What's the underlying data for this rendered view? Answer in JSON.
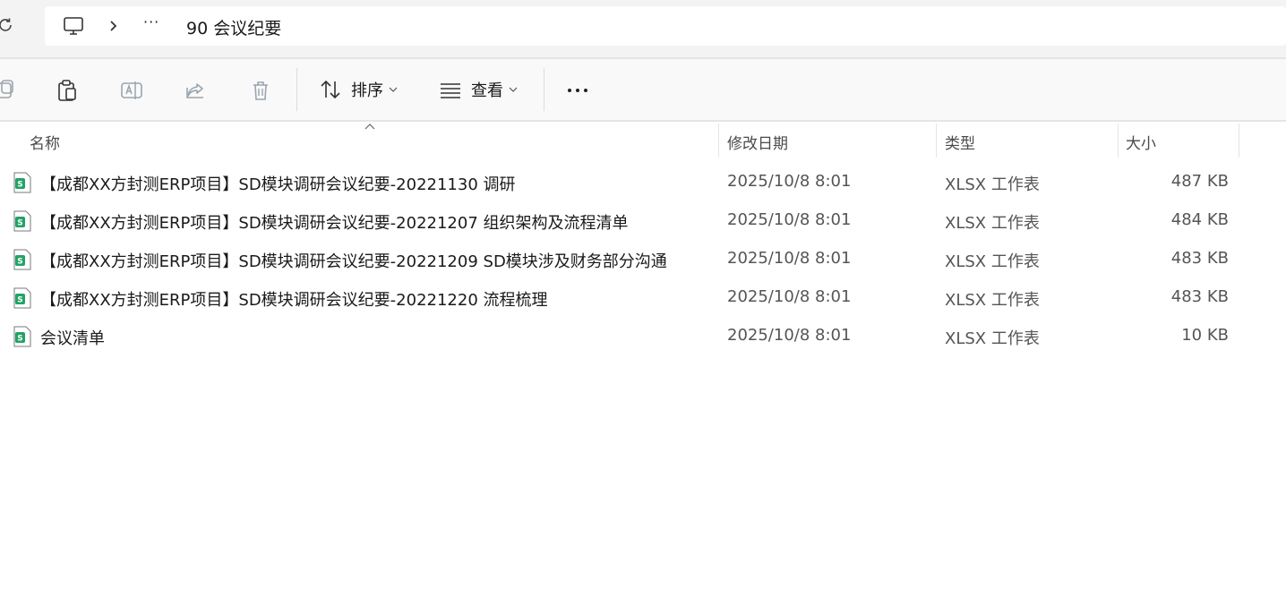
{
  "address": {
    "current_folder": "90 会议纪要",
    "overflow": "···"
  },
  "toolbar": {
    "sort_label": "排序",
    "view_label": "查看",
    "more": "···"
  },
  "columns": {
    "name": "名称",
    "date": "修改日期",
    "type": "类型",
    "size": "大小"
  },
  "files": [
    {
      "name": "【成都XX方封测ERP项目】SD模块调研会议纪要-20221130 调研",
      "date": "2025/10/8 8:01",
      "type": "XLSX 工作表",
      "size": "487 KB"
    },
    {
      "name": "【成都XX方封测ERP项目】SD模块调研会议纪要-20221207 组织架构及流程清单",
      "date": "2025/10/8 8:01",
      "type": "XLSX 工作表",
      "size": "484 KB"
    },
    {
      "name": "【成都XX方封测ERP项目】SD模块调研会议纪要-20221209  SD模块涉及财务部分沟通",
      "date": "2025/10/8 8:01",
      "type": "XLSX 工作表",
      "size": "483 KB"
    },
    {
      "name": "【成都XX方封测ERP项目】SD模块调研会议纪要-20221220 流程梳理",
      "date": "2025/10/8 8:01",
      "type": "XLSX 工作表",
      "size": "483 KB"
    },
    {
      "name": "会议清单",
      "date": "2025/10/8 8:01",
      "type": "XLSX 工作表",
      "size": "10 KB"
    }
  ],
  "colors": {
    "accent": "#005fb8",
    "xlsx_green": "#21a366",
    "disabled": "#9aa4ae"
  }
}
